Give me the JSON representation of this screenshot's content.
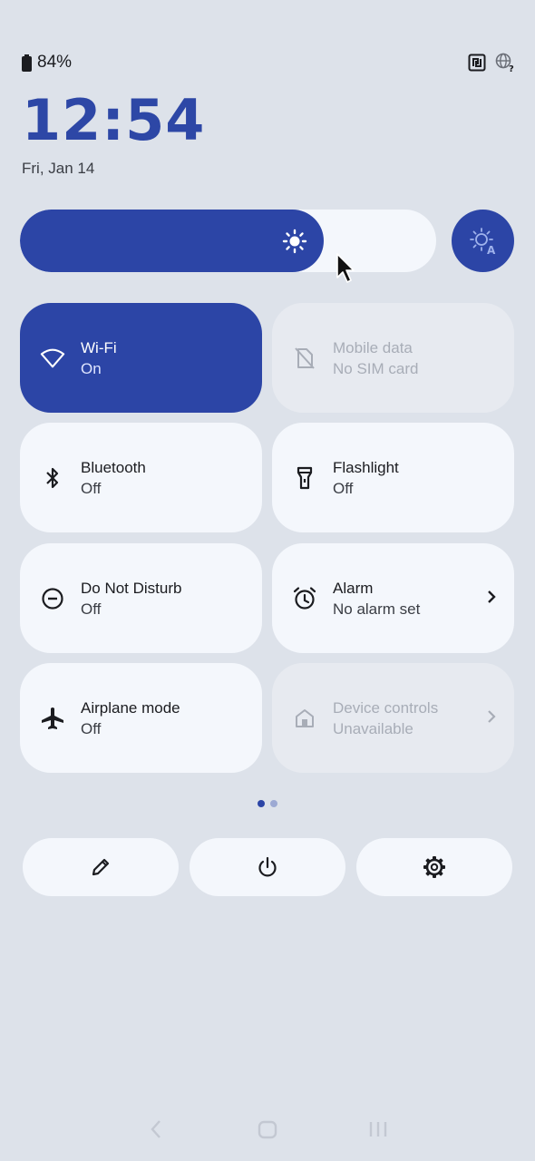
{
  "status": {
    "battery": "84%",
    "icons": [
      "nfc-icon",
      "globe-question-icon"
    ]
  },
  "clock": {
    "time": "12:54",
    "date": "Fri, Jan 14"
  },
  "brightness": {
    "level": 0.73,
    "icon": "sun-icon",
    "auto_icon": "auto-brightness-icon"
  },
  "tiles": [
    {
      "label": "Wi-Fi",
      "sub": "On",
      "icon": "wifi-icon",
      "state": "active"
    },
    {
      "label": "Mobile data",
      "sub": "No SIM card",
      "icon": "no-sim-icon",
      "state": "disabled"
    },
    {
      "label": "Bluetooth",
      "sub": "Off",
      "icon": "bluetooth-icon",
      "state": "off"
    },
    {
      "label": "Flashlight",
      "sub": "Off",
      "icon": "flashlight-icon",
      "state": "off"
    },
    {
      "label": "Do Not Disturb",
      "sub": "Off",
      "icon": "do-not-disturb-icon",
      "state": "off"
    },
    {
      "label": "Alarm",
      "sub": "No alarm set",
      "icon": "alarm-icon",
      "state": "off",
      "chevron": true
    },
    {
      "label": "Airplane mode",
      "sub": "Off",
      "icon": "airplane-icon",
      "state": "off"
    },
    {
      "label": "Device controls",
      "sub": "Unavailable",
      "icon": "home-icon",
      "state": "disabled",
      "chevron": true
    }
  ],
  "pager": {
    "pages": 2,
    "current": 1
  },
  "actions": [
    "edit-icon",
    "power-icon",
    "settings-icon"
  ],
  "colors": {
    "accent": "#2c45a6",
    "background": "#dde2ea",
    "tile": "#f4f7fc"
  }
}
